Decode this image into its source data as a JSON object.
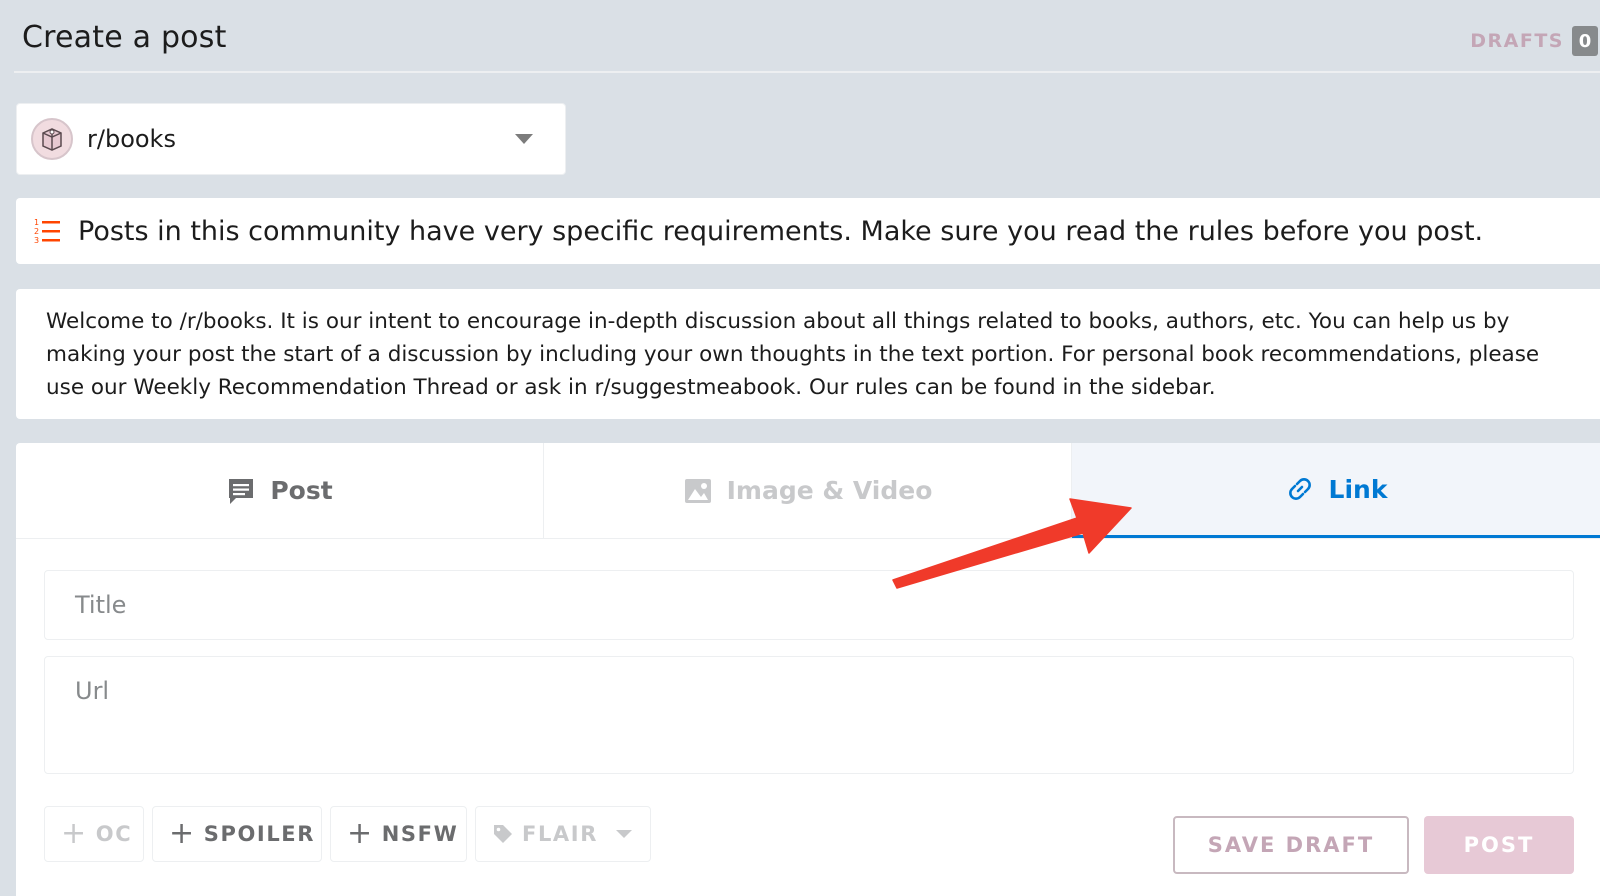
{
  "header": {
    "title": "Create a post",
    "drafts_label": "DRAFTS",
    "drafts_count": "0"
  },
  "community": {
    "name": "r/books",
    "icon": "books-avatar-icon"
  },
  "notice": {
    "icon": "list-numbered-icon",
    "text": "Posts in this community have very specific requirements. Make sure you read the rules before you post."
  },
  "welcome": {
    "text": "Welcome to /r/books. It is our intent to encourage in-depth discussion about all things related to books, authors, etc. You can help us by making your post the start of a discussion by including your own thoughts in the text portion. For personal book recommendations, please use our Weekly Recommendation Thread or ask in r/suggestmeabook. Our rules can be found in the sidebar."
  },
  "tabs": [
    {
      "label": "Post",
      "icon": "post-icon",
      "state": "inactive"
    },
    {
      "label": "Image & Video",
      "icon": "image-icon",
      "state": "disabled"
    },
    {
      "label": "Link",
      "icon": "link-icon",
      "state": "active"
    }
  ],
  "form": {
    "title_placeholder": "Title",
    "url_placeholder": "Url"
  },
  "tags": {
    "oc": "OC",
    "spoiler": "SPOILER",
    "nsfw": "NSFW",
    "flair": "FLAIR"
  },
  "actions": {
    "save_draft": "SAVE DRAFT",
    "post": "POST"
  },
  "colors": {
    "accent": "#0079d3",
    "notice_icon": "#ff4500",
    "annotation_arrow": "#f03a2a",
    "background": "#dae0e6"
  }
}
